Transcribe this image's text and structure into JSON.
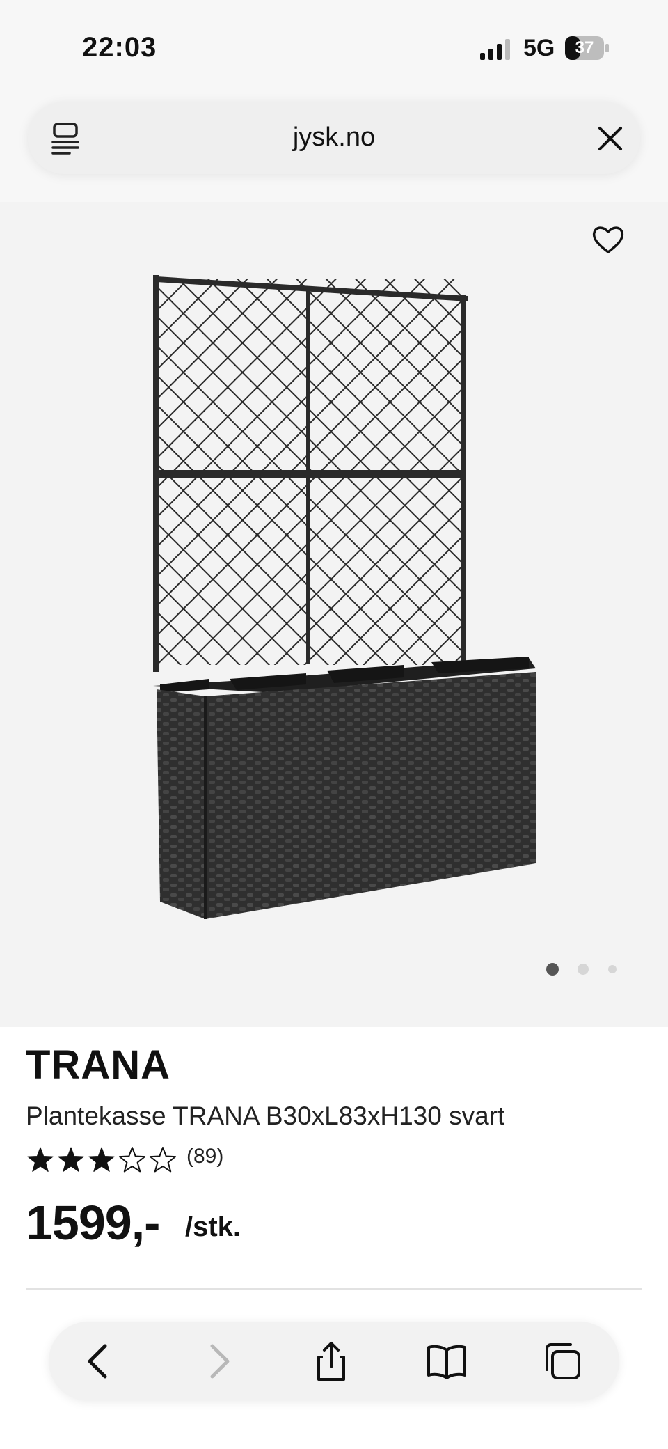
{
  "status_bar": {
    "time": "22:03",
    "network": "5G",
    "battery": "37",
    "icons": [
      "signal-icon",
      "battery-icon"
    ]
  },
  "browser": {
    "url": "jysk.no",
    "icons": [
      "reader-icon",
      "close-icon"
    ]
  },
  "gallery": {
    "image_count": 3,
    "active_index": 0,
    "icons": [
      "heart-icon"
    ]
  },
  "product": {
    "brand": "TRANA",
    "name": "Plantekasse TRANA B30xL83xH130 svart",
    "rating": 3,
    "rating_max": 5,
    "reviews": "(89)",
    "price": "1599,-",
    "unit": "/stk."
  },
  "toolbar": {
    "icons": [
      "back-icon",
      "forward-icon",
      "share-icon",
      "bookmarks-icon",
      "tabs-icon"
    ],
    "forward_enabled": false
  },
  "colors": {
    "text": "#111111",
    "image_bg": "#f3f3f3",
    "star": "#111111",
    "dot_active": "#555555",
    "dot_inactive": "#d6d6d6"
  }
}
